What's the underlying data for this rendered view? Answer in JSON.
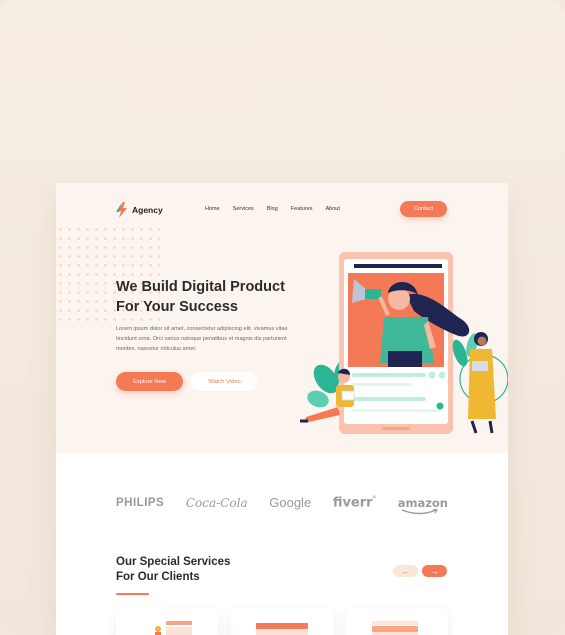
{
  "brand": {
    "name": "Agency"
  },
  "nav": {
    "links": [
      "Home",
      "Services",
      "Blog",
      "Features",
      "About"
    ],
    "contact_label": "Contact"
  },
  "hero": {
    "title_line1": "We Build Digital Product",
    "title_line2": "For Your Success",
    "body": "Lorem ipsum dolor sit amet, consectetur adipiscing elit. vivamus vitae tincidunt urna. Orci varius natoque penatibus et magnis dis parturient montes, nascetur ridiculus amet.",
    "primary_cta": "Explore Now",
    "secondary_cta": "Watch Video"
  },
  "clients": [
    "PHILIPS",
    "Coca-Cola",
    "Google",
    "fiverr",
    "amazon"
  ],
  "fiverr_mark": "°",
  "services": {
    "title_line1": "Our Special Services",
    "title_line2": "For Our Clients",
    "prev_arrow": "←",
    "next_arrow": "→"
  },
  "colors": {
    "accent": "#f47a57",
    "hero_bg": "#fcf5ef",
    "outer_bg": "#f3e9de",
    "teal": "#5ccfb0",
    "navy": "#1f2450"
  },
  "icons": [
    "logo-mark-icon",
    "megaphone-icon",
    "arrow-left-icon",
    "arrow-right-icon"
  ]
}
